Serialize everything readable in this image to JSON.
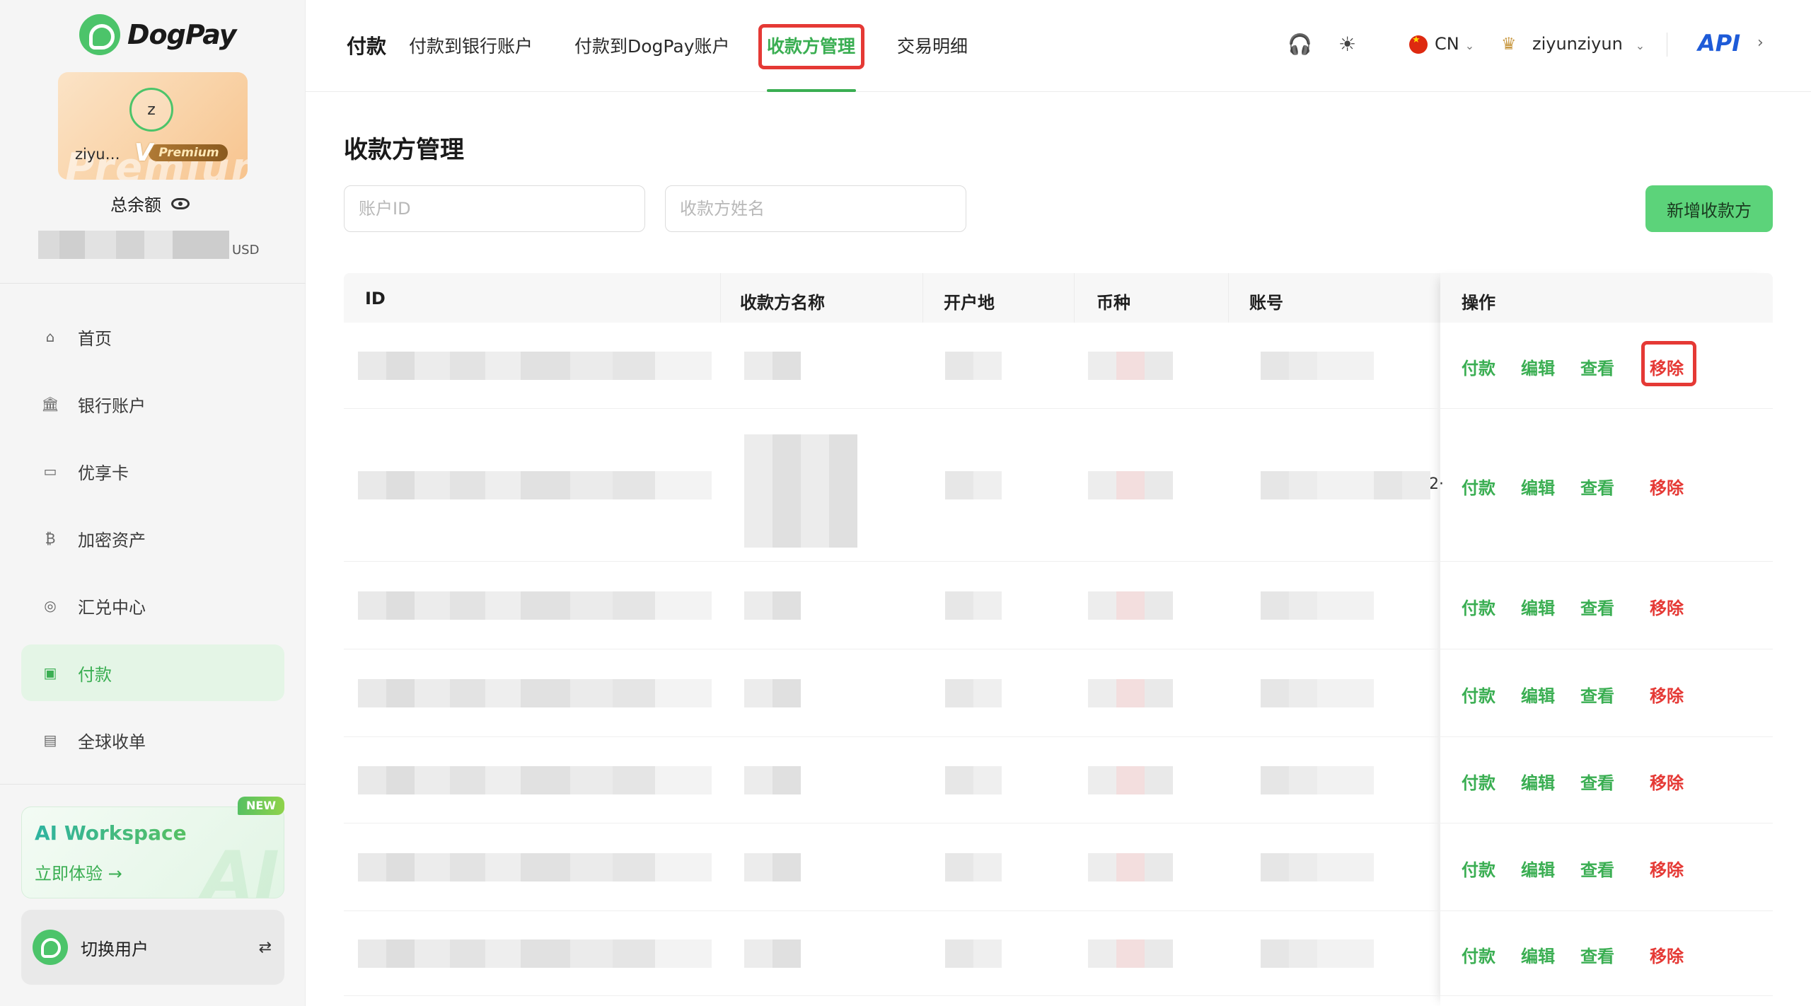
{
  "sidebar": {
    "logo_text": "DogPay",
    "user_initial": "z",
    "user_name": "ziyu…",
    "premium_label": "Premium",
    "card_watermark": "Premium",
    "balance_label": "总余额",
    "balance_currency": "USD",
    "nav": [
      {
        "label": "首页",
        "icon": "home-icon"
      },
      {
        "label": "银行账户",
        "icon": "bank-icon"
      },
      {
        "label": "优享卡",
        "icon": "card-icon"
      },
      {
        "label": "加密资产",
        "icon": "bitcoin-icon"
      },
      {
        "label": "汇兑中心",
        "icon": "exchange-icon"
      },
      {
        "label": "付款",
        "icon": "wallet-icon",
        "active": true
      },
      {
        "label": "全球收单",
        "icon": "receipt-icon"
      }
    ],
    "ai": {
      "badge": "NEW",
      "title": "AI Workspace",
      "cta": "立即体验 →",
      "bg_text": "AI"
    },
    "switch_user_label": "切换用户"
  },
  "topbar": {
    "section": "付款",
    "tabs": [
      "付款到银行账户",
      "付款到DogPay账户",
      "收款方管理",
      "交易明细"
    ],
    "active_tab": "收款方管理",
    "lang": "CN",
    "username": "ziyunziyun",
    "api_label": "API"
  },
  "main": {
    "title": "收款方管理",
    "account_id_placeholder": "账户ID",
    "payee_name_placeholder": "收款方姓名",
    "add_button": "新增收款方",
    "columns": [
      "ID",
      "收款方名称",
      "开户地",
      "币种",
      "账号",
      "操作"
    ],
    "actions": {
      "pay": "付款",
      "edit": "编辑",
      "view": "查看",
      "remove": "移除"
    },
    "truncated_text": "2·",
    "rows": 7
  },
  "colors": {
    "accent": "#3aae52",
    "danger": "#e53935",
    "button": "#5cd37a",
    "api": "#1e5bd8"
  }
}
